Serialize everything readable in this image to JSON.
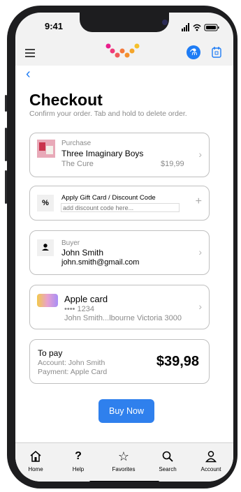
{
  "status_bar": {
    "time": "9:41"
  },
  "app_bar": {
    "accent": "#1e7cf5",
    "icons": [
      "menu-icon",
      "accessibility-icon",
      "calendar-icon"
    ]
  },
  "header": {
    "back_label": "‹",
    "title": "Checkout",
    "subtitle": "Confirm your order. Tab and hold to delete order."
  },
  "purchase": {
    "label": "Purchase",
    "name": "Three Imaginary Boys",
    "artist": "The Cure",
    "price": "$19,99"
  },
  "discount": {
    "icon": "%",
    "label": "Apply Gift Card / Discount Code",
    "placeholder": "add discount code here..."
  },
  "buyer": {
    "label": "Buyer",
    "name": "John Smith",
    "email": "john.smith@gmail.com"
  },
  "payment": {
    "card_name": "Apple card",
    "card_number": "•••• 1234",
    "card_address": "John Smith...lbourne Victoria 3000"
  },
  "summary": {
    "title": "To pay",
    "account_line": "Account: John Smith",
    "payment_line": "Payment: Apple Card",
    "total": "$39,98"
  },
  "buy_button": {
    "label": "Buy Now",
    "color": "#2f80ed"
  },
  "tabs": [
    {
      "label": "Home",
      "icon": "home-icon"
    },
    {
      "label": "Help",
      "icon": "help-icon"
    },
    {
      "label": "Favorites",
      "icon": "star-icon"
    },
    {
      "label": "Search",
      "icon": "search-icon"
    },
    {
      "label": "Account",
      "icon": "account-icon"
    }
  ]
}
